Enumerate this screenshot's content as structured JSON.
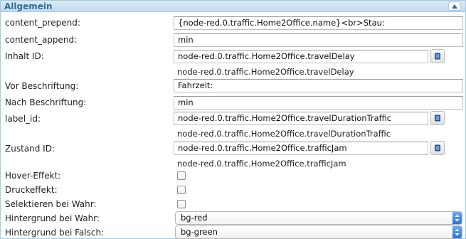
{
  "header": {
    "title": "Allgemein",
    "collapse_icon": "chevron-up-icon"
  },
  "rows": {
    "content_prepend": {
      "label": "content_prepend:",
      "value": "{node-red.0.traffic.Home2Office.name}<br>Stau:"
    },
    "content_append": {
      "label": "content_append:",
      "value": "min"
    },
    "inhalt_id": {
      "label": "Inhalt ID:",
      "value": "node-red.0.traffic.Home2Office.travelDelay",
      "hint": "node-red.0.traffic.Home2Office.travelDelay"
    },
    "vor_beschriftung": {
      "label": "Vor Beschriftung:",
      "value": "Fahrzeit:"
    },
    "nach_beschriftung": {
      "label": "Nach Beschriftung:",
      "value": "min"
    },
    "label_id": {
      "label": "label_id:",
      "value": "node-red.0.traffic.Home2Office.travelDurationTraffic",
      "hint": "node-red.0.traffic.Home2Office.travelDurationTraffic"
    },
    "zustand_id": {
      "label": "Zustand ID:",
      "value": "node-red.0.traffic.Home2Office.trafficJam",
      "hint": "node-red.0.traffic.Home2Office.trafficJam"
    },
    "hover_effekt": {
      "label": "Hover-Effekt:",
      "checked": false
    },
    "druckeffekt": {
      "label": "Druckeffekt:",
      "checked": false
    },
    "selektieren": {
      "label": "Selektieren bei Wahr:",
      "checked": false
    },
    "hintergrund_wahr": {
      "label": "Hintergrund bei Wahr:",
      "value": "bg-red"
    },
    "hintergrund_falsch": {
      "label": "Hintergrund bei Falsch:",
      "value": "bg-green"
    }
  },
  "icons": {
    "select_id_button": "list-icon",
    "dropdown_arrows": "up-down-arrows-icon"
  },
  "colors": {
    "header_text": "#2e6e9e",
    "header_bg": "#c5dbec",
    "select_accent": "#2d73d8"
  }
}
